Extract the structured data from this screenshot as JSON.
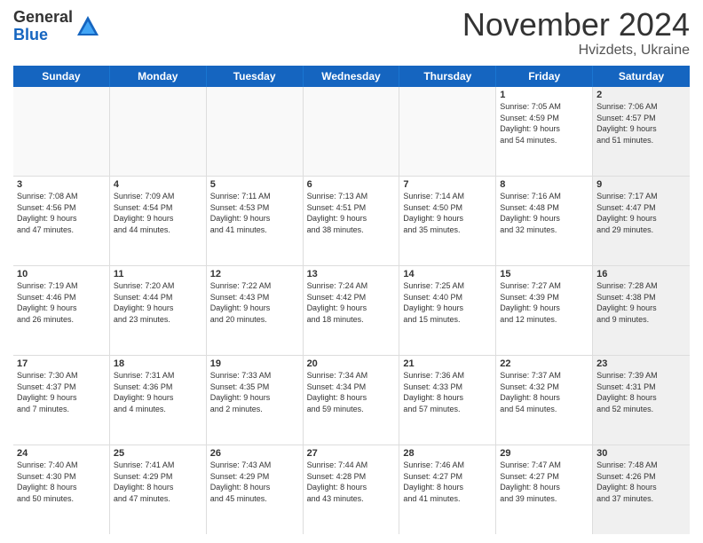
{
  "header": {
    "logo_general": "General",
    "logo_blue": "Blue",
    "month_title": "November 2024",
    "location": "Hvizdets, Ukraine"
  },
  "days_of_week": [
    "Sunday",
    "Monday",
    "Tuesday",
    "Wednesday",
    "Thursday",
    "Friday",
    "Saturday"
  ],
  "weeks": [
    [
      {
        "day": "",
        "info": "",
        "empty": true
      },
      {
        "day": "",
        "info": "",
        "empty": true
      },
      {
        "day": "",
        "info": "",
        "empty": true
      },
      {
        "day": "",
        "info": "",
        "empty": true
      },
      {
        "day": "",
        "info": "",
        "empty": true
      },
      {
        "day": "1",
        "info": "Sunrise: 7:05 AM\nSunset: 4:59 PM\nDaylight: 9 hours\nand 54 minutes."
      },
      {
        "day": "2",
        "info": "Sunrise: 7:06 AM\nSunset: 4:57 PM\nDaylight: 9 hours\nand 51 minutes.",
        "shaded": true
      }
    ],
    [
      {
        "day": "3",
        "info": "Sunrise: 7:08 AM\nSunset: 4:56 PM\nDaylight: 9 hours\nand 47 minutes."
      },
      {
        "day": "4",
        "info": "Sunrise: 7:09 AM\nSunset: 4:54 PM\nDaylight: 9 hours\nand 44 minutes."
      },
      {
        "day": "5",
        "info": "Sunrise: 7:11 AM\nSunset: 4:53 PM\nDaylight: 9 hours\nand 41 minutes."
      },
      {
        "day": "6",
        "info": "Sunrise: 7:13 AM\nSunset: 4:51 PM\nDaylight: 9 hours\nand 38 minutes."
      },
      {
        "day": "7",
        "info": "Sunrise: 7:14 AM\nSunset: 4:50 PM\nDaylight: 9 hours\nand 35 minutes."
      },
      {
        "day": "8",
        "info": "Sunrise: 7:16 AM\nSunset: 4:48 PM\nDaylight: 9 hours\nand 32 minutes."
      },
      {
        "day": "9",
        "info": "Sunrise: 7:17 AM\nSunset: 4:47 PM\nDaylight: 9 hours\nand 29 minutes.",
        "shaded": true
      }
    ],
    [
      {
        "day": "10",
        "info": "Sunrise: 7:19 AM\nSunset: 4:46 PM\nDaylight: 9 hours\nand 26 minutes."
      },
      {
        "day": "11",
        "info": "Sunrise: 7:20 AM\nSunset: 4:44 PM\nDaylight: 9 hours\nand 23 minutes."
      },
      {
        "day": "12",
        "info": "Sunrise: 7:22 AM\nSunset: 4:43 PM\nDaylight: 9 hours\nand 20 minutes."
      },
      {
        "day": "13",
        "info": "Sunrise: 7:24 AM\nSunset: 4:42 PM\nDaylight: 9 hours\nand 18 minutes."
      },
      {
        "day": "14",
        "info": "Sunrise: 7:25 AM\nSunset: 4:40 PM\nDaylight: 9 hours\nand 15 minutes."
      },
      {
        "day": "15",
        "info": "Sunrise: 7:27 AM\nSunset: 4:39 PM\nDaylight: 9 hours\nand 12 minutes."
      },
      {
        "day": "16",
        "info": "Sunrise: 7:28 AM\nSunset: 4:38 PM\nDaylight: 9 hours\nand 9 minutes.",
        "shaded": true
      }
    ],
    [
      {
        "day": "17",
        "info": "Sunrise: 7:30 AM\nSunset: 4:37 PM\nDaylight: 9 hours\nand 7 minutes."
      },
      {
        "day": "18",
        "info": "Sunrise: 7:31 AM\nSunset: 4:36 PM\nDaylight: 9 hours\nand 4 minutes."
      },
      {
        "day": "19",
        "info": "Sunrise: 7:33 AM\nSunset: 4:35 PM\nDaylight: 9 hours\nand 2 minutes."
      },
      {
        "day": "20",
        "info": "Sunrise: 7:34 AM\nSunset: 4:34 PM\nDaylight: 8 hours\nand 59 minutes."
      },
      {
        "day": "21",
        "info": "Sunrise: 7:36 AM\nSunset: 4:33 PM\nDaylight: 8 hours\nand 57 minutes."
      },
      {
        "day": "22",
        "info": "Sunrise: 7:37 AM\nSunset: 4:32 PM\nDaylight: 8 hours\nand 54 minutes."
      },
      {
        "day": "23",
        "info": "Sunrise: 7:39 AM\nSunset: 4:31 PM\nDaylight: 8 hours\nand 52 minutes.",
        "shaded": true
      }
    ],
    [
      {
        "day": "24",
        "info": "Sunrise: 7:40 AM\nSunset: 4:30 PM\nDaylight: 8 hours\nand 50 minutes."
      },
      {
        "day": "25",
        "info": "Sunrise: 7:41 AM\nSunset: 4:29 PM\nDaylight: 8 hours\nand 47 minutes."
      },
      {
        "day": "26",
        "info": "Sunrise: 7:43 AM\nSunset: 4:29 PM\nDaylight: 8 hours\nand 45 minutes."
      },
      {
        "day": "27",
        "info": "Sunrise: 7:44 AM\nSunset: 4:28 PM\nDaylight: 8 hours\nand 43 minutes."
      },
      {
        "day": "28",
        "info": "Sunrise: 7:46 AM\nSunset: 4:27 PM\nDaylight: 8 hours\nand 41 minutes."
      },
      {
        "day": "29",
        "info": "Sunrise: 7:47 AM\nSunset: 4:27 PM\nDaylight: 8 hours\nand 39 minutes."
      },
      {
        "day": "30",
        "info": "Sunrise: 7:48 AM\nSunset: 4:26 PM\nDaylight: 8 hours\nand 37 minutes.",
        "shaded": true
      }
    ]
  ]
}
